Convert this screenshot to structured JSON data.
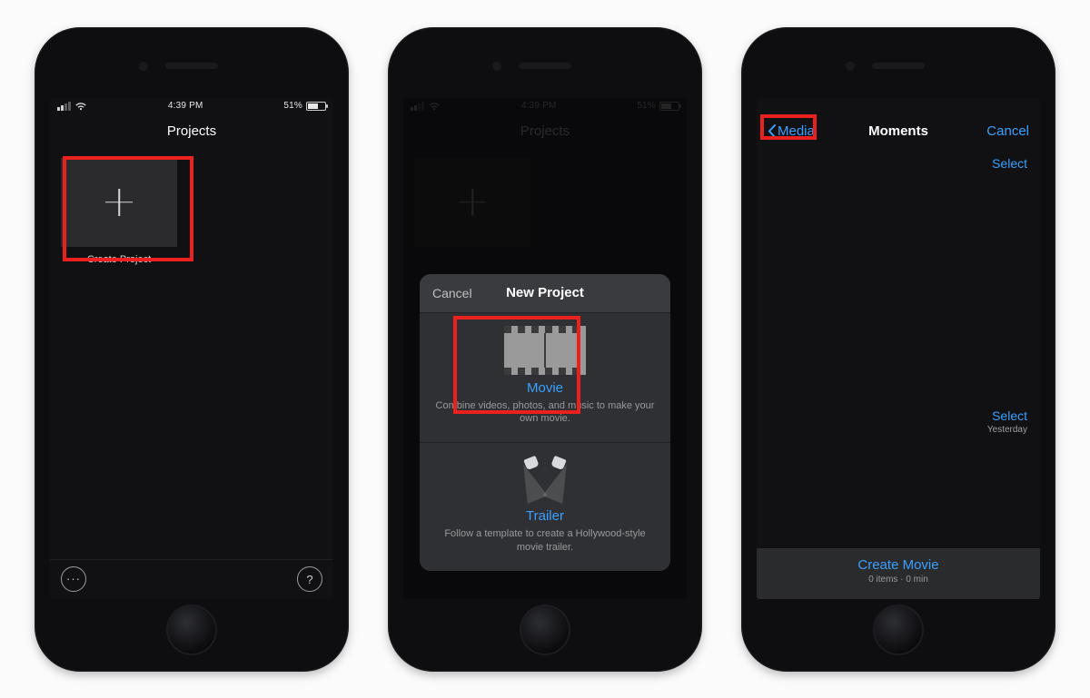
{
  "status": {
    "time": "4:39 PM",
    "battery_pct": "51%"
  },
  "screen1": {
    "nav_title": "Projects",
    "create_label": "Create Project",
    "more_glyph": "···",
    "help_glyph": "?"
  },
  "screen2": {
    "nav_title": "Projects",
    "modal": {
      "cancel": "Cancel",
      "title": "New Project",
      "movie": {
        "name": "Movie",
        "desc": "Combine videos, photos, and music to make your own movie."
      },
      "trailer": {
        "name": "Trailer",
        "desc": "Follow a template to create a Hollywood-style movie trailer."
      }
    }
  },
  "screen3": {
    "back_label": "Media",
    "nav_title": "Moments",
    "cancel": "Cancel",
    "select": "Select",
    "yesterday": "Yesterday",
    "create_movie": "Create Movie",
    "create_sub": "0 items · 0 min"
  }
}
